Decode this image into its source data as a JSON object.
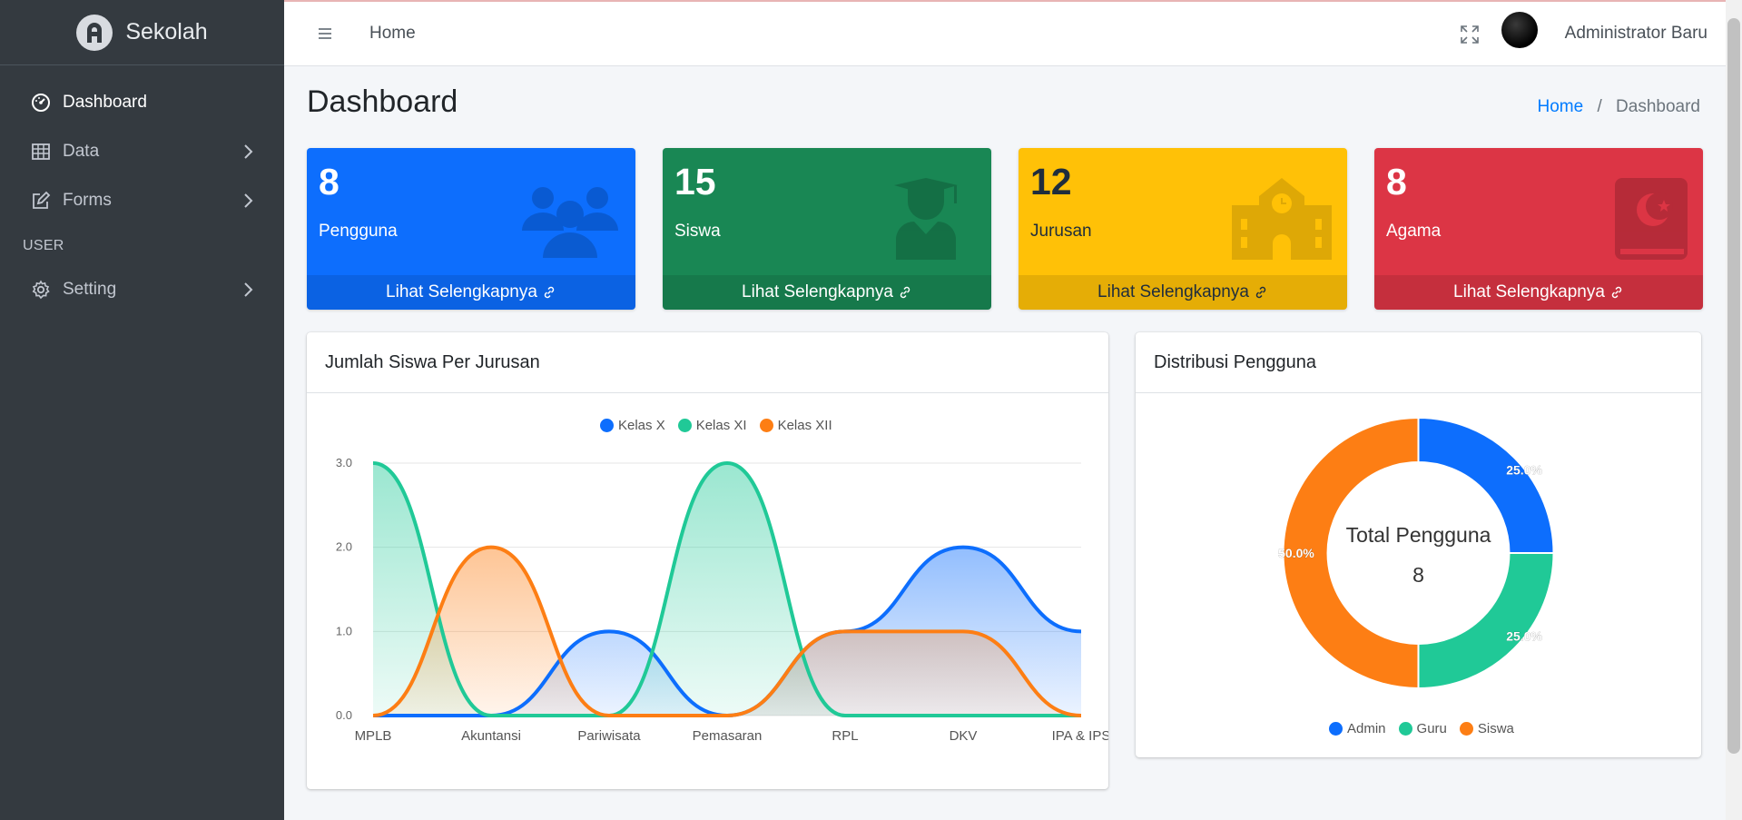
{
  "brand": {
    "name": "Sekolah"
  },
  "sidebar": {
    "items": [
      {
        "label": "Dashboard",
        "active": true
      },
      {
        "label": "Data"
      },
      {
        "label": "Forms"
      }
    ],
    "header": "USER",
    "setting": {
      "label": "Setting"
    }
  },
  "topbar": {
    "home": "Home",
    "user": "Administrator Baru"
  },
  "page": {
    "title": "Dashboard"
  },
  "breadcrumb": {
    "home": "Home",
    "sep": "/",
    "current": "Dashboard"
  },
  "boxes": [
    {
      "value": "8",
      "label": "Pengguna",
      "footer": "Lihat Selengkapnya",
      "color": "#0d6efd"
    },
    {
      "value": "15",
      "label": "Siswa",
      "footer": "Lihat Selengkapnya",
      "color": "#198754"
    },
    {
      "value": "12",
      "label": "Jurusan",
      "footer": "Lihat Selengkapnya",
      "color": "#ffc107"
    },
    {
      "value": "8",
      "label": "Agama",
      "footer": "Lihat Selengkapnya",
      "color": "#dc3545"
    }
  ],
  "cards": {
    "line_title": "Jumlah Siswa Per Jurusan",
    "pie_title": "Distribusi Pengguna"
  },
  "chart_data": [
    {
      "type": "area",
      "title": "",
      "xlabel": "",
      "ylabel": "",
      "categories": [
        "MPLB",
        "Akuntansi",
        "Pariwisata",
        "Pemasaran",
        "RPL",
        "DKV",
        "IPA & IPS"
      ],
      "yticks": [
        "0.0",
        "1.0",
        "2.0",
        "3.0"
      ],
      "ylim": [
        0,
        3
      ],
      "grid": true,
      "legend": "top",
      "series": [
        {
          "name": "Kelas X",
          "values": [
            0,
            0,
            1,
            0,
            1,
            2,
            1
          ],
          "color": "#0d6efd"
        },
        {
          "name": "Kelas XI",
          "values": [
            3,
            0,
            0,
            3,
            0,
            0,
            0
          ],
          "color": "#20c997"
        },
        {
          "name": "Kelas XII",
          "values": [
            0,
            2,
            0,
            0,
            1,
            1,
            0
          ],
          "color": "#fd7e14"
        }
      ]
    },
    {
      "type": "pie",
      "title": "",
      "center_label": "Total Pengguna",
      "center_value": "8",
      "legend": "bottom",
      "categories": [
        "Admin",
        "Guru",
        "Siswa"
      ],
      "values": [
        2,
        2,
        4
      ],
      "percent_labels": [
        "25.0%",
        "25.0%",
        "50.0%"
      ],
      "colors": [
        "#0d6efd",
        "#20c997",
        "#fd7e14"
      ]
    }
  ]
}
